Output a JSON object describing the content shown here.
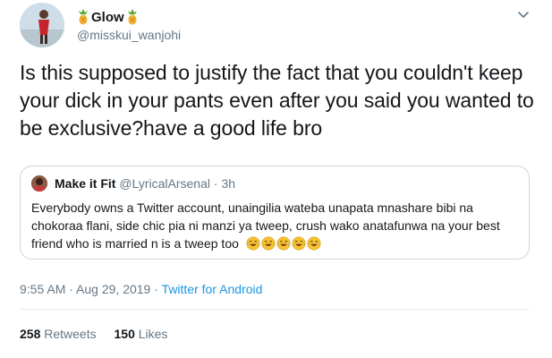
{
  "author": {
    "display_name": "Glow",
    "handle": "@misskui_wanjohi"
  },
  "tweet": {
    "text": "Is this supposed to justify the fact that you couldn't keep your dick in your pants even after you said you wanted to be exclusive?have a good life bro"
  },
  "quoted": {
    "name": "Make it Fit",
    "handle": "@LyricalArsenal",
    "separator": "·",
    "time": "3h",
    "text": "Everybody owns a Twitter account, unaingilia wateba unapata mnashare bibi na chokoraa flani, side chic pia ni manzi ya tweep, crush wako anatafunwa na your best friend who is married n is a tweep too",
    "emoji_count": 5,
    "emoji_icon": "face-with-tears-of-joy-icon"
  },
  "meta": {
    "time": "9:55 AM",
    "separator1": " · ",
    "date": "Aug 29, 2019",
    "separator2": " · ",
    "source": "Twitter for Android"
  },
  "stats": {
    "retweets_count": "258",
    "retweets_label": "Retweets",
    "likes_count": "150",
    "likes_label": "Likes"
  },
  "colors": {
    "link": "#1b95e0",
    "secondary_text": "#657786",
    "border": "#ccd6dd"
  }
}
